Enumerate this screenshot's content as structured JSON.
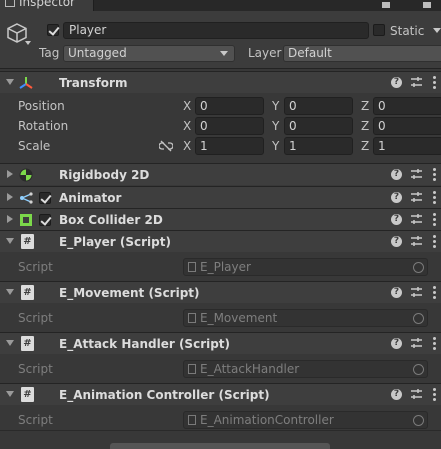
{
  "tab": {
    "label": "Inspector",
    "icon": "inspector-icon"
  },
  "header": {
    "active": true,
    "name": "Player",
    "static_label": "Static",
    "static_checked": false,
    "tag_label": "Tag",
    "tag_value": "Untagged",
    "layer_label": "Layer",
    "layer_value": "Default"
  },
  "transform": {
    "title": "Transform",
    "rows": [
      {
        "label": "Position",
        "x": "0",
        "y": "0",
        "z": "0"
      },
      {
        "label": "Rotation",
        "x": "0",
        "y": "0",
        "z": "0"
      },
      {
        "label": "Scale",
        "x": "1",
        "y": "1",
        "z": "1"
      }
    ],
    "axis": {
      "x": "X",
      "y": "Y",
      "z": "Z"
    }
  },
  "components": [
    {
      "title": "Rigidbody 2D",
      "icon": "rigidbody-2d-icon",
      "has_checkbox": false
    },
    {
      "title": "Animator",
      "icon": "animator-icon",
      "has_checkbox": true,
      "checked": true
    },
    {
      "title": "Box Collider 2D",
      "icon": "box-collider-2d-icon",
      "has_checkbox": true,
      "checked": true
    }
  ],
  "scripts": [
    {
      "title": "E_Player (Script)",
      "label": "Script",
      "value": "E_Player"
    },
    {
      "title": "E_Movement (Script)",
      "label": "Script",
      "value": "E_Movement"
    },
    {
      "title": "E_Attack Handler (Script)",
      "label": "Script",
      "value": "E_AttackHandler"
    },
    {
      "title": "E_Animation Controller (Script)",
      "label": "Script",
      "value": "E_AnimationController"
    }
  ],
  "help_symbol": "?",
  "colors": {
    "background": "#383838",
    "header": "#3e3e3e",
    "field": "#2a2a2a",
    "collider_green": "#7cd94a"
  }
}
